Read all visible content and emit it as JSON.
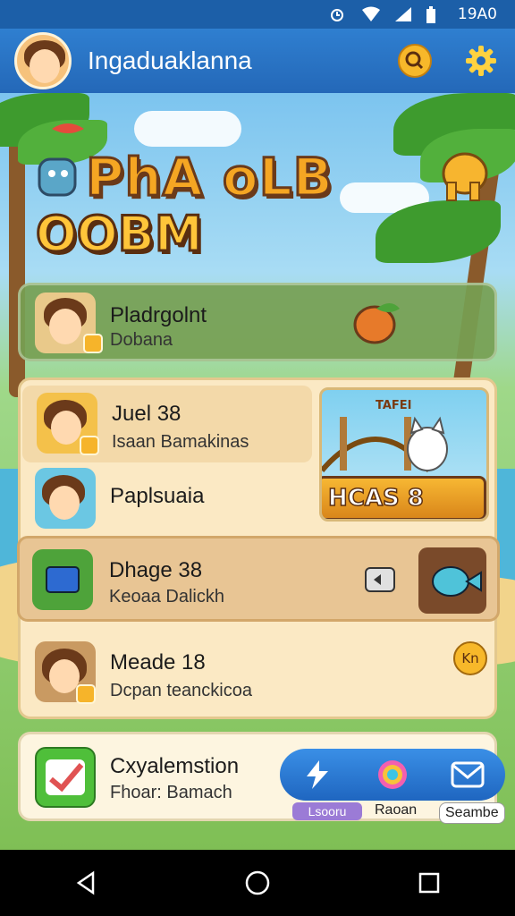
{
  "status_bar": {
    "time": "19A0",
    "icons": [
      "alarm-icon",
      "wifi-icon",
      "signal-icon",
      "battery-icon"
    ]
  },
  "app_bar": {
    "title": "Ingaduaklanna",
    "icons": [
      "profile-avatar",
      "search-coin-icon",
      "gear-icon"
    ]
  },
  "hero": {
    "logo_line1": "PhA  oLB",
    "logo_line2": "OOBM"
  },
  "top_panel": {
    "title": "Pladrgolnt",
    "subtitle": "Dobana"
  },
  "list": [
    {
      "title": "Juel  38",
      "subtitle": "Isaan Bamakinas"
    },
    {
      "title": "Paplsuaia",
      "subtitle": ""
    },
    {
      "title": "Dhage 38",
      "subtitle": "Keoaa Dalickh"
    },
    {
      "title": "Meade 18",
      "subtitle": "Dcpan teanckicoa"
    }
  ],
  "promo": {
    "tag": "TAFEI",
    "banner": "HCAS 8"
  },
  "coin_badge": "Kn",
  "bottom_panel": {
    "title": "Cxyalemstion",
    "subtitle": "Fhoar: Bamach",
    "labels": [
      "Lsooru",
      "Raoan",
      "Seambe"
    ]
  },
  "colors": {
    "app_bar": "#2468b8",
    "status_bar": "#1c5fa8",
    "accent": "#f5a623"
  }
}
